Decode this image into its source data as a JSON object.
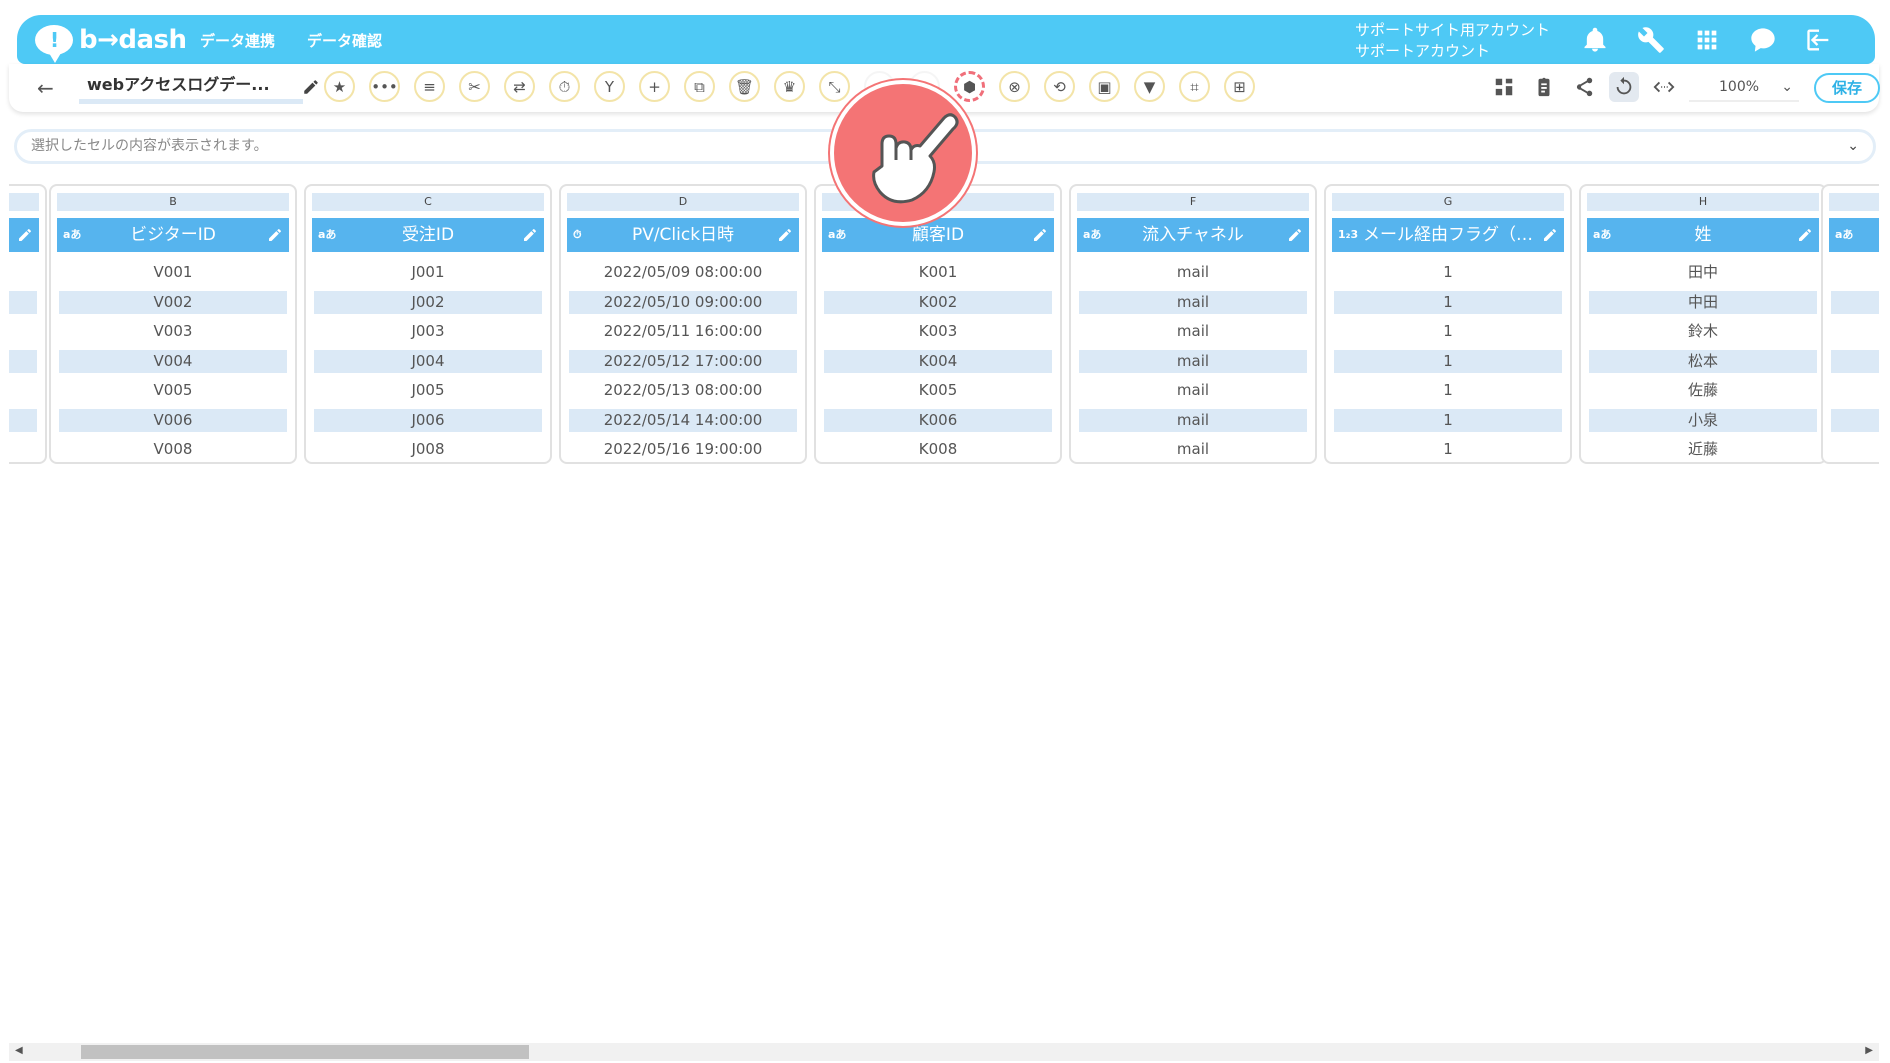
{
  "app": {
    "logo_text": "b→dash",
    "logo_mark": "!",
    "nav": [
      "データ連携",
      "データ確認"
    ],
    "account_line1": "サポートサイト用アカウント",
    "account_line2": "サポートアカウント"
  },
  "toolbar": {
    "back": "←",
    "title": "webアクセスログデー...",
    "tools": [
      "★",
      "•••",
      "≡",
      "✂",
      "⇄",
      "⏱",
      "Y",
      "+",
      "⧉",
      "🗑",
      "♛",
      "⤡",
      "",
      "",
      "⬢",
      "⊗",
      "⟲",
      "▣",
      "▼",
      "⌗",
      "⊞"
    ],
    "zoom": "100%",
    "save_label": "保存"
  },
  "cellbar": {
    "placeholder": "選択したセルの内容が表示されます。"
  },
  "grid": {
    "columns": [
      {
        "letter": "B",
        "type": "aあ",
        "header": "ビジターID",
        "cells": [
          "V001",
          "V002",
          "V003",
          "V004",
          "V005",
          "V006",
          "V008"
        ]
      },
      {
        "letter": "C",
        "type": "aあ",
        "header": "受注ID",
        "cells": [
          "J001",
          "J002",
          "J003",
          "J004",
          "J005",
          "J006",
          "J008"
        ]
      },
      {
        "letter": "D",
        "type": "⏱",
        "header": "PV/Click日時",
        "cells": [
          "2022/05/09 08:00:00",
          "2022/05/10 09:00:00",
          "2022/05/11 16:00:00",
          "2022/05/12 17:00:00",
          "2022/05/13 08:00:00",
          "2022/05/14 14:00:00",
          "2022/05/16 19:00:00"
        ]
      },
      {
        "letter": "",
        "type": "aあ",
        "header": "顧客ID",
        "cells": [
          "K001",
          "K002",
          "K003",
          "K004",
          "K005",
          "K006",
          "K008"
        ]
      },
      {
        "letter": "F",
        "type": "aあ",
        "header": "流入チャネル",
        "cells": [
          "mail",
          "mail",
          "mail",
          "mail",
          "mail",
          "mail",
          "mail"
        ]
      },
      {
        "letter": "G",
        "type": "1₂3",
        "header": "メール経由フラグ（…",
        "cells": [
          "1",
          "1",
          "1",
          "1",
          "1",
          "1",
          "1"
        ]
      },
      {
        "letter": "H",
        "type": "aあ",
        "header": "姓",
        "cells": [
          "田中",
          "中田",
          "鈴木",
          "松本",
          "佐藤",
          "小泉",
          "近藤"
        ]
      }
    ]
  },
  "colors": {
    "primary": "#4ec9f5",
    "header": "#56b4ee",
    "stripe": "#dbe9f6",
    "pointer": "#f47475"
  }
}
